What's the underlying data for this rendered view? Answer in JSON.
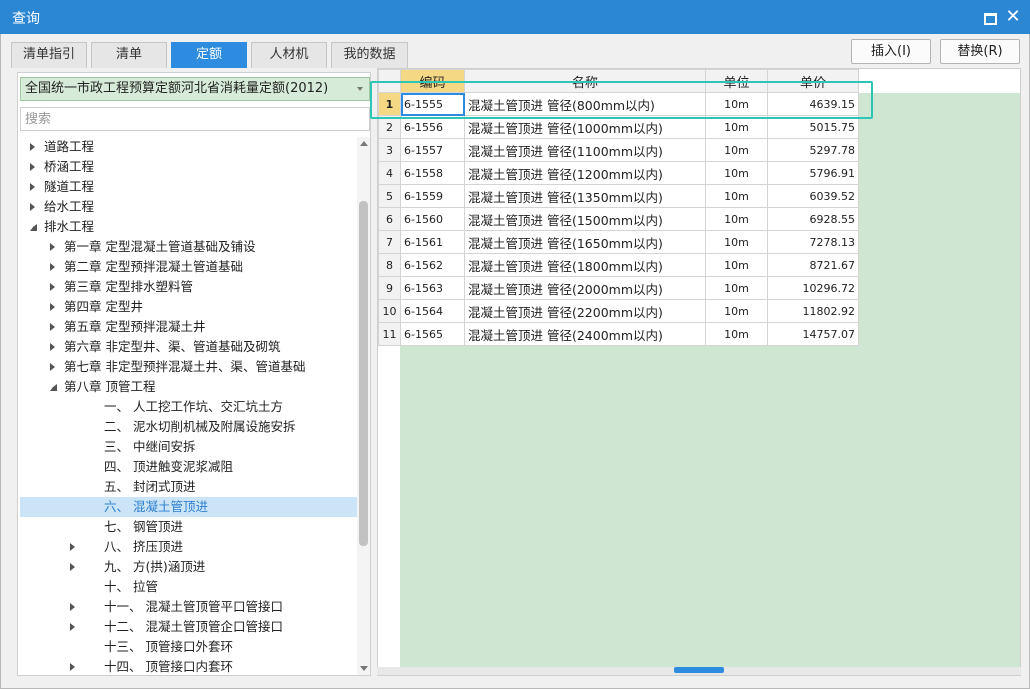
{
  "window": {
    "title": "查询",
    "close_glyph": "✕",
    "max_icon": "maximize-icon",
    "close_icon": "close-icon"
  },
  "tabs": [
    {
      "label": "清单指引",
      "active": false
    },
    {
      "label": "清单",
      "active": false
    },
    {
      "label": "定额",
      "active": true
    },
    {
      "label": "人材机",
      "active": false
    },
    {
      "label": "我的数据",
      "active": false
    }
  ],
  "actions": {
    "insert": "插入(I)",
    "replace": "替换(R)"
  },
  "library": {
    "selected": "全国统一市政工程预算定额河北省消耗量定额(2012)"
  },
  "search": {
    "placeholder": "搜索",
    "value": ""
  },
  "tree": [
    {
      "label": "道路工程",
      "level": 0,
      "state": "collapsed"
    },
    {
      "label": "桥涵工程",
      "level": 0,
      "state": "collapsed"
    },
    {
      "label": "隧道工程",
      "level": 0,
      "state": "collapsed"
    },
    {
      "label": "给水工程",
      "level": 0,
      "state": "collapsed"
    },
    {
      "label": "排水工程",
      "level": 0,
      "state": "expanded"
    },
    {
      "label": "第一章 定型混凝土管道基础及铺设",
      "level": 1,
      "state": "collapsed"
    },
    {
      "label": "第二章 定型预拌混凝土管道基础",
      "level": 1,
      "state": "collapsed"
    },
    {
      "label": "第三章 定型排水塑料管",
      "level": 1,
      "state": "collapsed"
    },
    {
      "label": "第四章 定型井",
      "level": 1,
      "state": "collapsed"
    },
    {
      "label": "第五章 定型预拌混凝土井",
      "level": 1,
      "state": "collapsed"
    },
    {
      "label": "第六章 非定型井、渠、管道基础及砌筑",
      "level": 1,
      "state": "collapsed"
    },
    {
      "label": "第七章 非定型预拌混凝土井、渠、管道基础",
      "level": 1,
      "state": "collapsed"
    },
    {
      "label": "第八章 顶管工程",
      "level": 1,
      "state": "expanded"
    },
    {
      "label": "一、 人工挖工作坑、交汇坑土方",
      "level": 2,
      "state": "none"
    },
    {
      "label": "二、 泥水切削机械及附属设施安拆",
      "level": 2,
      "state": "none"
    },
    {
      "label": "三、 中继间安拆",
      "level": 2,
      "state": "none"
    },
    {
      "label": "四、 顶进触变泥浆减阻",
      "level": 2,
      "state": "none"
    },
    {
      "label": "五、 封闭式顶进",
      "level": 2,
      "state": "none"
    },
    {
      "label": "六、 混凝土管顶进",
      "level": 2,
      "state": "none",
      "selected": true
    },
    {
      "label": "七、 钢管顶进",
      "level": 2,
      "state": "none"
    },
    {
      "label": "八、 挤压顶进",
      "level": 2,
      "state": "collapsed"
    },
    {
      "label": "九、 方(拱)涵顶进",
      "level": 2,
      "state": "collapsed"
    },
    {
      "label": "十、 拉管",
      "level": 2,
      "state": "none"
    },
    {
      "label": "十一、 混凝土管顶管平口管接口",
      "level": 2,
      "state": "collapsed"
    },
    {
      "label": "十二、 混凝土管顶管企口管接口",
      "level": 2,
      "state": "collapsed"
    },
    {
      "label": "十三、 顶管接口外套环",
      "level": 2,
      "state": "none"
    },
    {
      "label": "十四、 顶管接口内套环",
      "level": 2,
      "state": "collapsed"
    }
  ],
  "grid": {
    "columns": {
      "code": "编码",
      "name": "名称",
      "unit": "单位",
      "price": "单价"
    },
    "rows": [
      {
        "no": "1",
        "code": "6-1555",
        "name": "混凝土管顶进 管径(800mm以内)",
        "unit": "10m",
        "price": "4639.15"
      },
      {
        "no": "2",
        "code": "6-1556",
        "name": "混凝土管顶进 管径(1000mm以内)",
        "unit": "10m",
        "price": "5015.75"
      },
      {
        "no": "3",
        "code": "6-1557",
        "name": "混凝土管顶进 管径(1100mm以内)",
        "unit": "10m",
        "price": "5297.78"
      },
      {
        "no": "4",
        "code": "6-1558",
        "name": "混凝土管顶进 管径(1200mm以内)",
        "unit": "10m",
        "price": "5796.91"
      },
      {
        "no": "5",
        "code": "6-1559",
        "name": "混凝土管顶进 管径(1350mm以内)",
        "unit": "10m",
        "price": "6039.52"
      },
      {
        "no": "6",
        "code": "6-1560",
        "name": "混凝土管顶进 管径(1500mm以内)",
        "unit": "10m",
        "price": "6928.55"
      },
      {
        "no": "7",
        "code": "6-1561",
        "name": "混凝土管顶进 管径(1650mm以内)",
        "unit": "10m",
        "price": "7278.13"
      },
      {
        "no": "8",
        "code": "6-1562",
        "name": "混凝土管顶进 管径(1800mm以内)",
        "unit": "10m",
        "price": "8721.67"
      },
      {
        "no": "9",
        "code": "6-1563",
        "name": "混凝土管顶进 管径(2000mm以内)",
        "unit": "10m",
        "price": "10296.72"
      },
      {
        "no": "10",
        "code": "6-1564",
        "name": "混凝土管顶进 管径(2200mm以内)",
        "unit": "10m",
        "price": "11802.92"
      },
      {
        "no": "11",
        "code": "6-1565",
        "name": "混凝土管顶进 管径(2400mm以内)",
        "unit": "10m",
        "price": "14757.07"
      }
    ]
  },
  "colors": {
    "titlebar": "#2b87d3",
    "accent": "#2d8ce0",
    "highlight": "#2ec4b6",
    "empty_area": "#cfe6d3"
  }
}
